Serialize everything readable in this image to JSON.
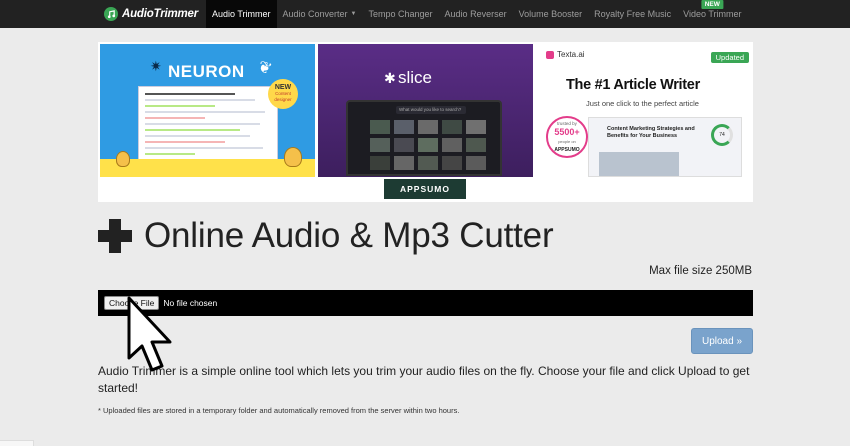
{
  "navbar": {
    "brand": "AudioTrimmer",
    "items": [
      {
        "label": "Audio Trimmer",
        "active": true
      },
      {
        "label": "Audio Converter",
        "dropdown": true
      },
      {
        "label": "Tempo Changer"
      },
      {
        "label": "Audio Reverser"
      },
      {
        "label": "Volume Booster"
      },
      {
        "label": "Royalty Free Music"
      },
      {
        "label": "Video Trimmer",
        "badge": "NEW"
      }
    ]
  },
  "ads": {
    "neuron": {
      "title": "NEURON",
      "badge_new": "NEW",
      "badge_sub": "Content designer"
    },
    "slice": {
      "title": "slice",
      "search": "What would you like to search?"
    },
    "texta": {
      "logo": "Texta.ai",
      "updated": "Updated",
      "headline": "The #1 Article Writer",
      "sub": "Just one click to the perfect article",
      "badge_top": "trusted by",
      "badge_count": "5500+",
      "badge_mid": "people on",
      "badge_brand": "APPSUMO",
      "panel_text": "Content Marketing Strategies and Benefits for Your Business",
      "gauge": "74"
    },
    "appsumo": "APPSUMO"
  },
  "main": {
    "title": "Online Audio & Mp3 Cutter",
    "max_size": "Max file size 250MB",
    "choose_file": "Choose File",
    "no_file": "No file chosen",
    "upload": "Upload »",
    "description": "Audio Trimmer is a simple online tool which lets you trim your audio files on the fly. Choose your file and click Upload to get started!",
    "note": "* Uploaded files are stored in a temporary folder and automatically removed from the server within two hours."
  },
  "colors": {
    "navbar_bg": "#222222",
    "page_bg": "#ebebeb",
    "upload_btn": "#7aa3cc",
    "brand_green": "#3aa655"
  }
}
